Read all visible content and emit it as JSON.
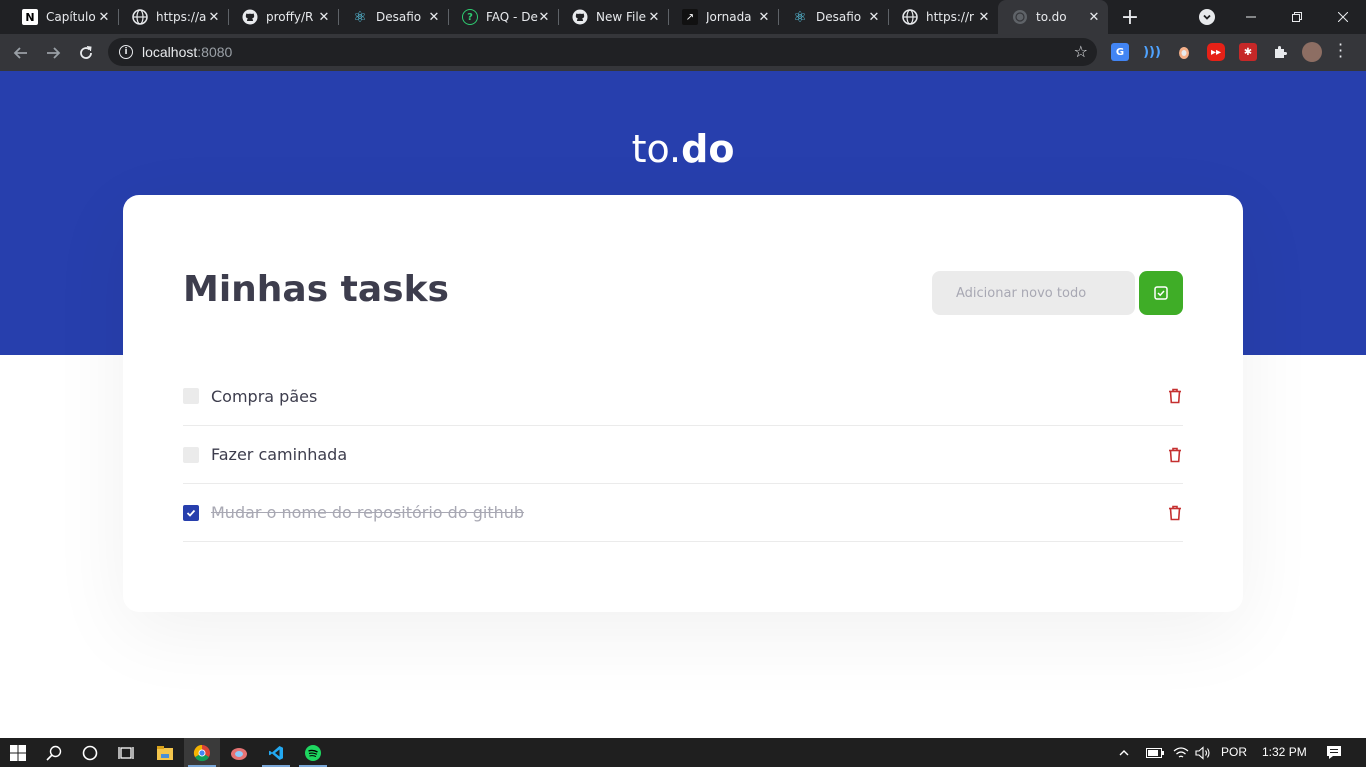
{
  "browser": {
    "tabs": [
      {
        "title": "Capítulo",
        "icon": "notion-icon",
        "glyph": "N"
      },
      {
        "title": "https://a",
        "icon": "globe-icon",
        "glyph": "🌐"
      },
      {
        "title": "proffy/R",
        "icon": "github-icon",
        "glyph": "●"
      },
      {
        "title": "Desafio",
        "icon": "react-icon",
        "glyph": "⚛"
      },
      {
        "title": "FAQ - De",
        "icon": "help-circle-icon",
        "glyph": "?"
      },
      {
        "title": "New File",
        "icon": "github-icon",
        "glyph": "●"
      },
      {
        "title": "Jornada",
        "icon": "rocketseat-icon",
        "glyph": "↗"
      },
      {
        "title": "Desafio",
        "icon": "react-icon",
        "glyph": "⚛"
      },
      {
        "title": "https://r",
        "icon": "globe-icon",
        "glyph": "🌐"
      },
      {
        "title": "to.do",
        "icon": "globe-icon",
        "glyph": "●",
        "active": true
      }
    ],
    "url": {
      "host": "localhost",
      "port": ":8080"
    },
    "extensions": [
      "google-translate-icon",
      "wifi-extension-icon",
      "extension-orange-icon",
      "youtube-extension-icon",
      "extension-red-icon",
      "puzzle-icon"
    ]
  },
  "app": {
    "brand_light": "to.",
    "brand_bold": "do",
    "heading": "Minhas tasks",
    "input_placeholder": "Adicionar novo todo",
    "tasks": [
      {
        "title": "Compra pães",
        "done": false
      },
      {
        "title": "Fazer caminhada",
        "done": false
      },
      {
        "title": "Mudar o nome do repositório do github",
        "done": true
      }
    ],
    "colors": {
      "primary": "#273fad",
      "success": "#3fad27",
      "danger": "#c53030",
      "text": "#3d3d4d"
    }
  },
  "taskbar": {
    "language": "POR",
    "time": "1:32 PM"
  }
}
